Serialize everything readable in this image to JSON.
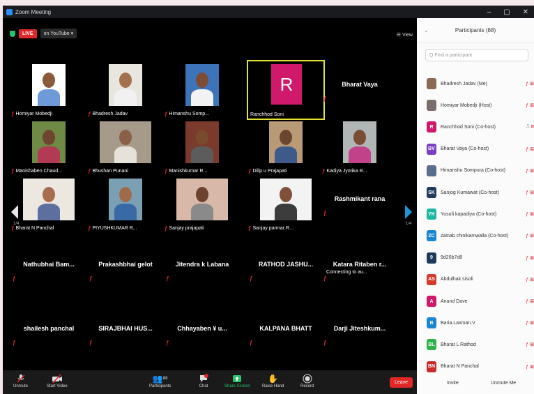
{
  "window": {
    "title": "Zoom Meeting",
    "controls": [
      "–",
      "▢",
      "✕"
    ]
  },
  "meeting": {
    "live_label": "LIVE",
    "stream_label": "on YouTube ▾",
    "view_label": "☰ View",
    "page_left": "1/4",
    "page_right": "1/4"
  },
  "tiles": [
    {
      "name": "Homiyar Mobedji",
      "type": "video"
    },
    {
      "name": "Bhadresh Jadav",
      "type": "video"
    },
    {
      "name": "Himanshu Somp...",
      "type": "video"
    },
    {
      "name": "Ranchhod Soni",
      "type": "avatar",
      "initial": "R"
    },
    {
      "name": "Bharat Vaya",
      "type": "name"
    },
    {
      "name": "Manishaben Chaud...",
      "type": "video"
    },
    {
      "name": "Bhushan Punani",
      "type": "video"
    },
    {
      "name": "Manishkumar R...",
      "type": "video"
    },
    {
      "name": "Dilip u Prajapati",
      "type": "video"
    },
    {
      "name": "Kadiya Jyotika R...",
      "type": "video"
    },
    {
      "name": "Bharat N Panchal",
      "type": "video"
    },
    {
      "name": "PIYUSHKUMAR R...",
      "type": "video"
    },
    {
      "name": "Sanjay prajapati",
      "type": "video"
    },
    {
      "name": "Sanjay parmar R...",
      "type": "video"
    },
    {
      "name": "Rashmikant rana",
      "type": "name"
    },
    {
      "name": "Nathubhai Bam...",
      "type": "name"
    },
    {
      "name": "Prakashbhai gelot",
      "type": "name"
    },
    {
      "name": "Jitendra k Labana",
      "type": "name"
    },
    {
      "name": "RATHOD JASHU...",
      "type": "name"
    },
    {
      "name": "Katara Ritaben r...",
      "type": "name",
      "status": "Connecting to au..."
    },
    {
      "name": "shailesh panchal",
      "type": "name"
    },
    {
      "name": "SIRAJBHAI HUS...",
      "type": "name"
    },
    {
      "name": "Chhayaben ¥ u...",
      "type": "name"
    },
    {
      "name": "KALPANA BHATT",
      "type": "name"
    },
    {
      "name": "Darji Jiteshkum...",
      "type": "name"
    }
  ],
  "toolbar": {
    "unmute": "Unmute",
    "start_video": "Start Video",
    "participants": "Participants",
    "participants_count": "88",
    "chat": "Chat",
    "share": "Share Screen",
    "raise": "Raise Hand",
    "record": "Record",
    "leave": "Leave"
  },
  "panel": {
    "title": "Participants (88)",
    "search_placeholder": "Q Find a participant",
    "invite": "Invite",
    "unmute_me": "Unmute Me",
    "participants": [
      {
        "name": "Bhadresh Jadav (Me)",
        "initials": "",
        "color": "#8a6a55"
      },
      {
        "name": "Homiyar Mobedji (Host)",
        "initials": "",
        "color": "#7a6f6a"
      },
      {
        "name": "Ranchhod Soni (Co-host)",
        "initials": "R",
        "color": "#d0196a"
      },
      {
        "name": "Bharat Vaya (Co-host)",
        "initials": "BV",
        "color": "#7b3fc4"
      },
      {
        "name": "Himanshu Sompura (Co-host)",
        "initials": "",
        "color": "#5a6d8c"
      },
      {
        "name": "Sanjog Kumawat (Co-host)",
        "initials": "SK",
        "color": "#1f3a5c"
      },
      {
        "name": "Yusufi kapadiya (Co-host)",
        "initials": "YK",
        "color": "#1cb6a3"
      },
      {
        "name": "zainab chinikamwalla (Co-host)",
        "initials": "ZC",
        "color": "#1a86d0"
      },
      {
        "name": "9d20b7d8",
        "initials": "9",
        "color": "#1f3a5c"
      },
      {
        "name": "Abdulhak sisoli",
        "initials": "AS",
        "color": "#d33a2c"
      },
      {
        "name": "Anand Dave",
        "initials": "A",
        "color": "#d0196a"
      },
      {
        "name": "Baria.Laxman.V",
        "initials": "B",
        "color": "#1a86d0"
      },
      {
        "name": "Bharat L Rathod",
        "initials": "BL",
        "color": "#2fb24a"
      },
      {
        "name": "Bharat N Panchal",
        "initials": "BN",
        "color": "#c72b2b"
      }
    ]
  }
}
